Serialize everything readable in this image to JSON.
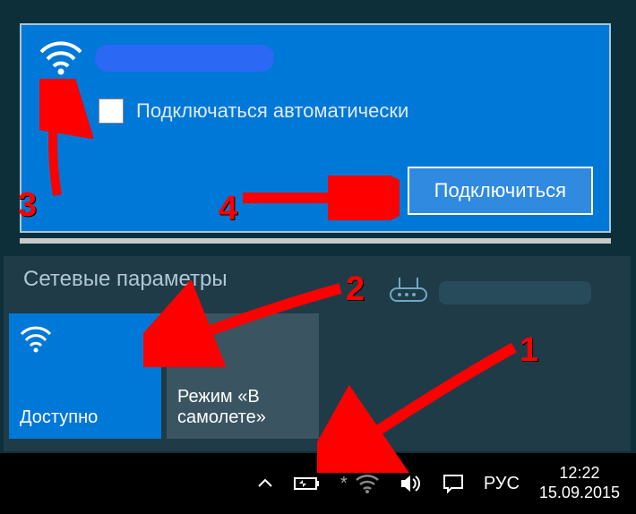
{
  "network": {
    "auto_connect_label": "Подключаться автоматически",
    "connect_button_label": "Подключиться"
  },
  "settings": {
    "title": "Сетевые параметры",
    "wifi_tile_label": "Доступно",
    "airplane_tile_label": "Режим «В самолете»"
  },
  "tray": {
    "ime": "РУС",
    "time": "12:22",
    "date": "15.09.2015"
  },
  "annotations": {
    "n1": "1",
    "n2": "2",
    "n3": "3",
    "n4": "4"
  },
  "colors": {
    "accent": "#0078d7",
    "annotation": "#ff0000"
  }
}
